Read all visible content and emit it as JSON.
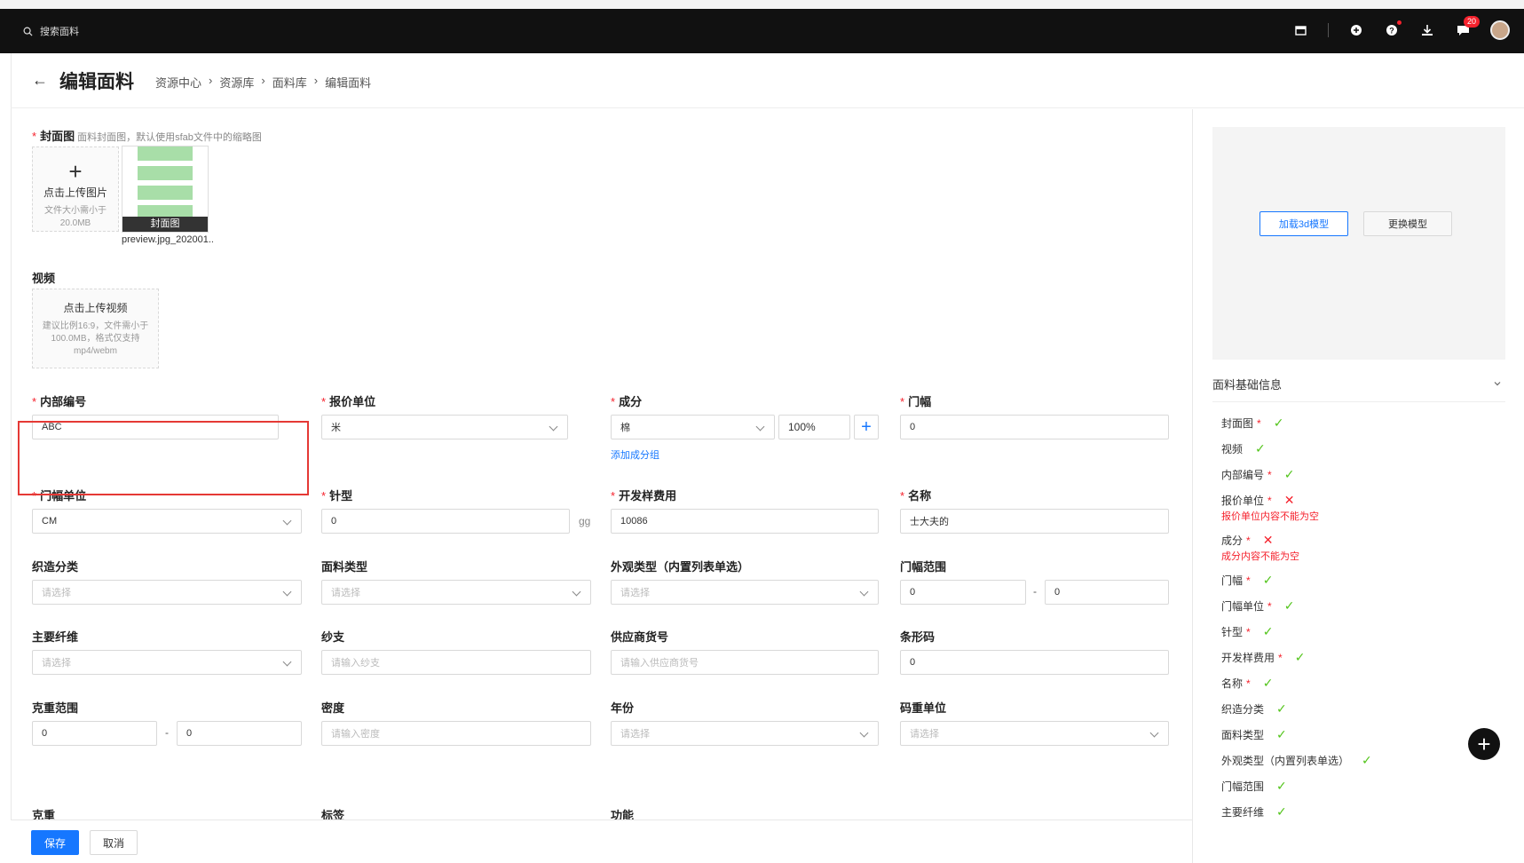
{
  "topbar": {
    "search_placeholder": "搜索面料",
    "badge_count": "20"
  },
  "header": {
    "back_icon": "←",
    "title": "编辑面料",
    "breadcrumb": [
      "资源中心",
      "资源库",
      "面料库",
      "编辑面料"
    ],
    "separator": "›"
  },
  "cover": {
    "label": "封面图",
    "hint": "面料封面图，默认使用sfab文件中的缩略图",
    "upload_plus": "+",
    "upload_text": "点击上传图片",
    "upload_sub": "文件大小需小于20.0MB",
    "thumb_caption": "封面图",
    "thumb_filename": "preview.jpg_202001..."
  },
  "video": {
    "label": "视频",
    "upload_text": "点击上传视频",
    "upload_sub": "建议比例16:9，文件需小于100.0MB，格式仅支持mp4/webm"
  },
  "form": {
    "internal_no": {
      "label": "内部编号",
      "value": "ABC"
    },
    "price_unit": {
      "label": "报价单位",
      "value": "米"
    },
    "composition": {
      "label": "成分",
      "material": "棉",
      "percent": "100%",
      "add_btn": "+",
      "add_group": "添加成分组"
    },
    "width": {
      "label": "门幅",
      "value": "0"
    },
    "width_unit": {
      "label": "门幅单位",
      "value": "CM"
    },
    "needle": {
      "label": "针型",
      "value": "0",
      "suffix": "gg"
    },
    "dev_fee": {
      "label": "开发样费用",
      "value": "10086"
    },
    "name": {
      "label": "名称",
      "value": "士大夫的"
    },
    "weave": {
      "label": "织造分类",
      "placeholder": "请选择"
    },
    "fabric_type": {
      "label": "面料类型",
      "placeholder": "请选择"
    },
    "appearance": {
      "label": "外观类型（内置列表单选）",
      "placeholder": "请选择"
    },
    "width_range": {
      "label": "门幅范围",
      "min": "0",
      "max": "0",
      "dash": "-"
    },
    "fiber": {
      "label": "主要纤维",
      "placeholder": "请选择"
    },
    "yarn": {
      "label": "纱支",
      "placeholder": "请输入纱支"
    },
    "supplier_no": {
      "label": "供应商货号",
      "placeholder": "请输入供应商货号"
    },
    "barcode": {
      "label": "条形码",
      "value": "0"
    },
    "gram_range": {
      "label": "克重范围",
      "min": "0",
      "max": "0",
      "dash": "-"
    },
    "density": {
      "label": "密度",
      "placeholder": "请输入密度"
    },
    "year": {
      "label": "年份",
      "placeholder": "请选择"
    },
    "weight_unit": {
      "label": "码重单位",
      "placeholder": "请选择"
    },
    "gram": {
      "label": "克重"
    },
    "tags": {
      "label": "标签"
    },
    "function": {
      "label": "功能"
    }
  },
  "actions": {
    "save": "保存",
    "cancel": "取消"
  },
  "right_panel": {
    "load_3d": "加载3d模型",
    "change_model": "更换模型",
    "section_title": "面料基础信息",
    "checklist": [
      {
        "label": "封面图",
        "required": true,
        "ok": true
      },
      {
        "label": "视频",
        "required": false,
        "ok": true
      },
      {
        "label": "内部编号",
        "required": true,
        "ok": true
      },
      {
        "label": "报价单位",
        "required": true,
        "ok": false,
        "error": "报价单位内容不能为空"
      },
      {
        "label": "成分",
        "required": true,
        "ok": false,
        "error": "成分内容不能为空"
      },
      {
        "label": "门幅",
        "required": true,
        "ok": true
      },
      {
        "label": "门幅单位",
        "required": true,
        "ok": true
      },
      {
        "label": "针型",
        "required": true,
        "ok": true
      },
      {
        "label": "开发样费用",
        "required": true,
        "ok": true
      },
      {
        "label": "名称",
        "required": true,
        "ok": true
      },
      {
        "label": "织造分类",
        "required": false,
        "ok": true
      },
      {
        "label": "面料类型",
        "required": false,
        "ok": true
      },
      {
        "label": "外观类型（内置列表单选）",
        "required": false,
        "ok": true
      },
      {
        "label": "门幅范围",
        "required": false,
        "ok": true
      },
      {
        "label": "主要纤维",
        "required": false,
        "ok": true
      }
    ]
  },
  "fab": "+",
  "colors": {
    "primary": "#1677ff",
    "error": "#f5222d",
    "success": "#52c41a",
    "topbar": "#111111"
  }
}
